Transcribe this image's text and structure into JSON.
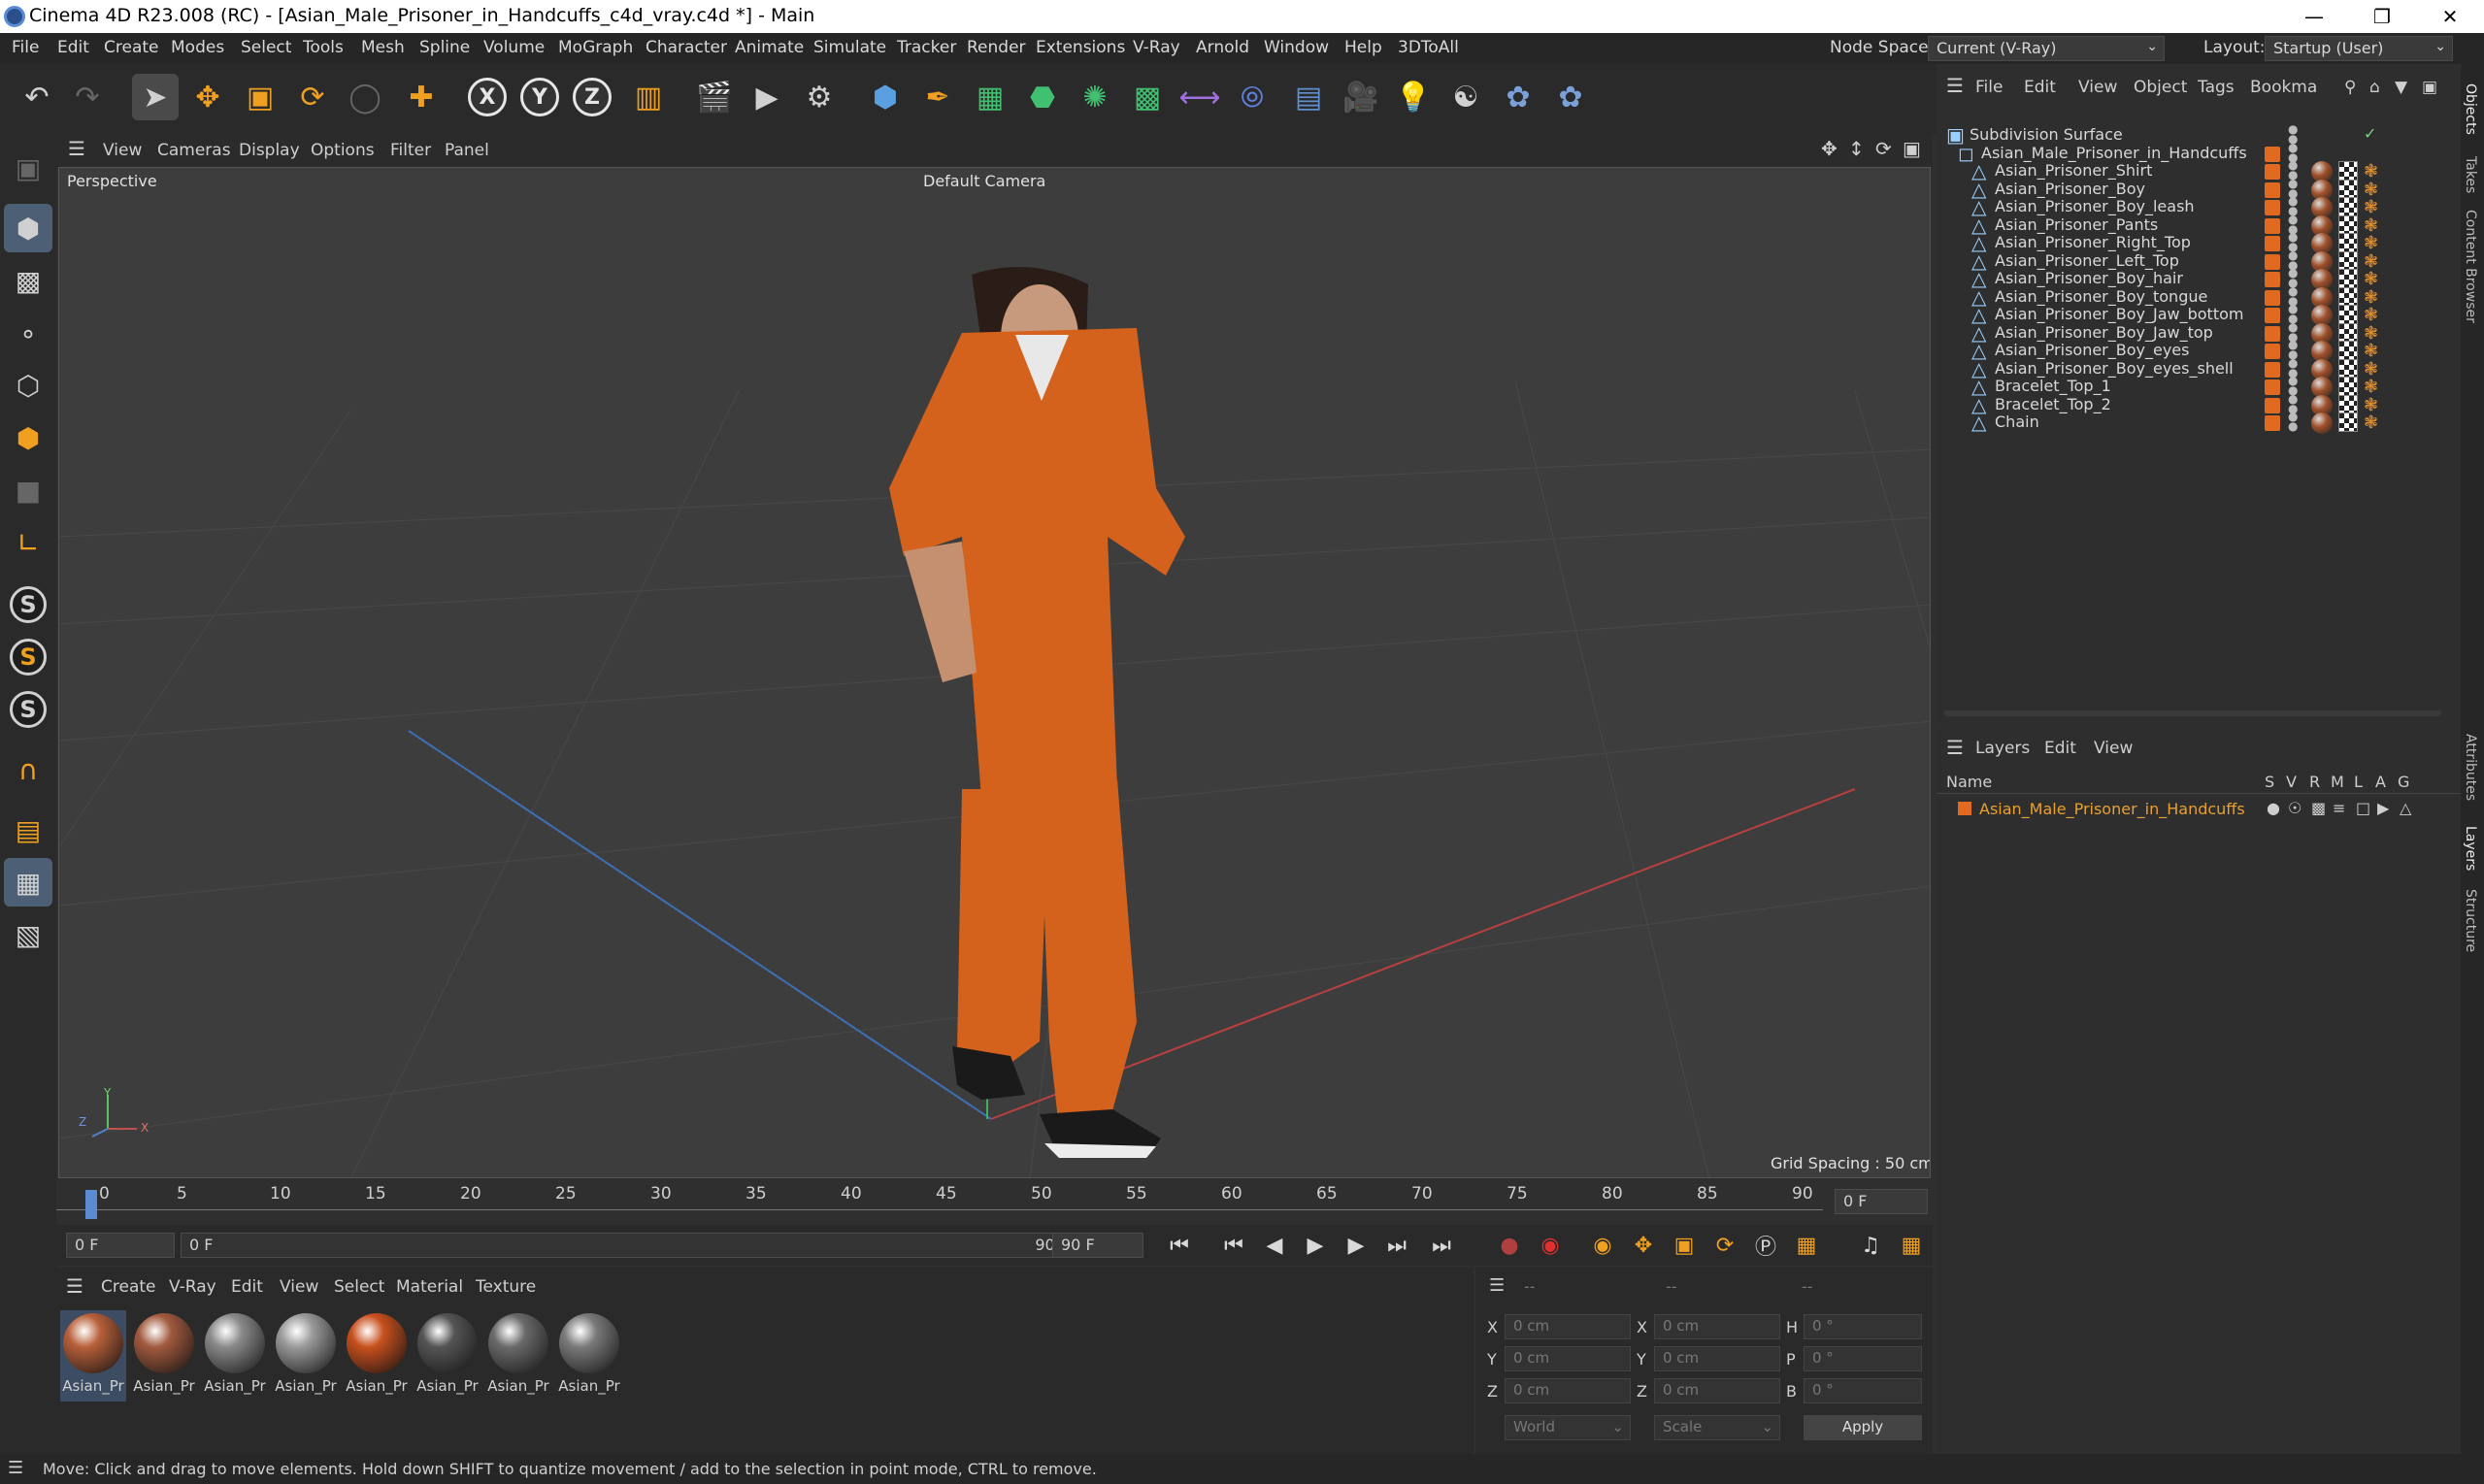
{
  "window": {
    "title": "Cinema 4D R23.008 (RC) - [Asian_Male_Prisoner_in_Handcuffs_c4d_vray.c4d *] - Main"
  },
  "menu": [
    "File",
    "Edit",
    "Create",
    "Modes",
    "Select",
    "Tools",
    "Mesh",
    "Spline",
    "Volume",
    "MoGraph",
    "Character",
    "Animate",
    "Simulate",
    "Tracker",
    "Render",
    "Extensions",
    "V-Ray",
    "Arnold",
    "Window",
    "Help",
    "3DToAll"
  ],
  "nodespace": {
    "label": "Node Space:",
    "value": "Current (V-Ray)"
  },
  "layout": {
    "label": "Layout:",
    "value": "Startup (User)"
  },
  "viewport_menu": [
    "View",
    "Cameras",
    "Display",
    "Options",
    "Filter",
    "Panel"
  ],
  "viewport": {
    "name": "Perspective",
    "camera": "Default Camera",
    "grid_spacing": "Grid Spacing : 50 cm",
    "axis_x": "X",
    "axis_y": "Y",
    "axis_z": "Z"
  },
  "timeline": {
    "ticks": [
      "0",
      "5",
      "10",
      "15",
      "20",
      "25",
      "30",
      "35",
      "40",
      "45",
      "50",
      "55",
      "60",
      "65",
      "70",
      "75",
      "80",
      "85",
      "90"
    ],
    "current_frame": "0 F"
  },
  "playbar": {
    "start": "0 F",
    "range_start": "0 F",
    "range_end": "90 F",
    "end": "90 F"
  },
  "material_menu": [
    "Create",
    "V-Ray",
    "Edit",
    "View",
    "Select",
    "Material",
    "Texture"
  ],
  "materials": [
    {
      "label": "Asian_Pr",
      "color": "#b8603a"
    },
    {
      "label": "Asian_Pr",
      "color": "#a25a3e"
    },
    {
      "label": "Asian_Pr",
      "color": "#8a8a8a"
    },
    {
      "label": "Asian_Pr",
      "color": "#9a9a9a"
    },
    {
      "label": "Asian_Pr",
      "color": "#c8501e"
    },
    {
      "label": "Asian_Pr",
      "color": "#555555"
    },
    {
      "label": "Asian_Pr",
      "color": "#6a6a6a"
    },
    {
      "label": "Asian_Pr",
      "color": "#7a7a7a"
    }
  ],
  "coords": {
    "header_left": "--",
    "header_mid": "--",
    "header_right": "--",
    "rows": [
      {
        "a": "X",
        "av": "0 cm",
        "b": "X",
        "bv": "0 cm",
        "c": "H",
        "cv": "0 °"
      },
      {
        "a": "Y",
        "av": "0 cm",
        "b": "Y",
        "bv": "0 cm",
        "c": "P",
        "cv": "0 °"
      },
      {
        "a": "Z",
        "av": "0 cm",
        "b": "Z",
        "bv": "0 cm",
        "c": "B",
        "cv": "0 °"
      }
    ],
    "world": "World",
    "scale": "Scale",
    "apply": "Apply"
  },
  "object_menu": [
    "File",
    "Edit",
    "View",
    "Object",
    "Tags",
    "Bookma"
  ],
  "objects": {
    "root": "Subdivision Surface",
    "group": "Asian_Male_Prisoner_in_Handcuffs",
    "children": [
      "Asian_Prisoner_Shirt",
      "Asian_Prisoner_Boy",
      "Asian_Prisoner_Boy_leash",
      "Asian_Prisoner_Pants",
      "Asian_Prisoner_Right_Top",
      "Asian_Prisoner_Left_Top",
      "Asian_Prisoner_Boy_hair",
      "Asian_Prisoner_Boy_tongue",
      "Asian_Prisoner_Boy_Jaw_bottom",
      "Asian_Prisoner_Boy_Jaw_top",
      "Asian_Prisoner_Boy_eyes",
      "Asian_Prisoner_Boy_eyes_shell",
      "Bracelet_Top_1",
      "Bracelet_Top_2",
      "Chain"
    ]
  },
  "layers_menu": [
    "Layers",
    "Edit",
    "View"
  ],
  "layers": {
    "columns": [
      "Name",
      "S",
      "V",
      "R",
      "M",
      "L",
      "A",
      "G"
    ],
    "items": [
      {
        "name": "Asian_Male_Prisoner_in_Handcuffs"
      }
    ]
  },
  "right_tabs": [
    "Objects",
    "Takes",
    "Content Browser",
    "Attributes",
    "Layers",
    "Structure"
  ],
  "status": "Move: Click and drag to move elements. Hold down SHIFT to quantize movement / add to the selection in point mode, CTRL to remove.",
  "colors": {
    "accent": "#e06a20",
    "selection": "#4d5f75",
    "layer_text": "#e8a030"
  }
}
